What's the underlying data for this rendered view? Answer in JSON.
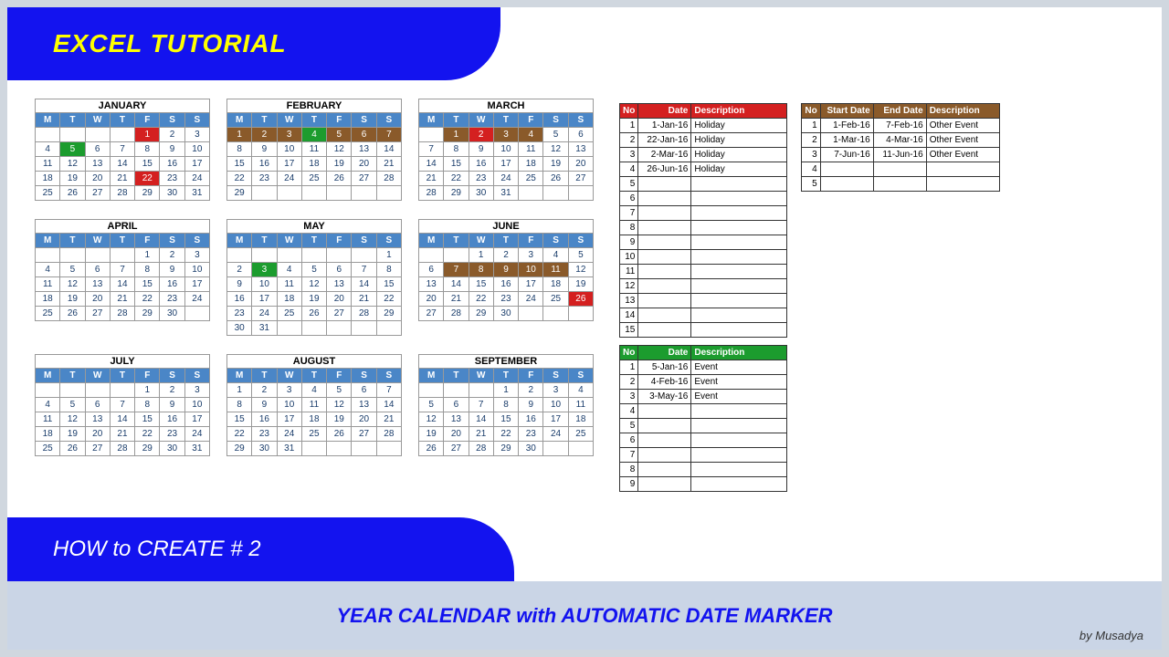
{
  "header": {
    "title": "EXCEL TUTORIAL"
  },
  "subheader": {
    "title": "HOW to CREATE # 2"
  },
  "footer": {
    "title": "YEAR CALENDAR with AUTOMATIC DATE MARKER",
    "byline": "by Musadya"
  },
  "dow": [
    "M",
    "T",
    "W",
    "T",
    "F",
    "S",
    "S"
  ],
  "months": [
    {
      "name": "JANUARY",
      "offset": 4,
      "days": 31,
      "marks": {
        "1": "red",
        "5": "green",
        "22": "red"
      }
    },
    {
      "name": "FEBRUARY",
      "offset": 0,
      "days": 29,
      "marks": {
        "1": "brown",
        "2": "brown",
        "3": "brown",
        "4": "green",
        "5": "brown",
        "6": "brown",
        "7": "brown"
      }
    },
    {
      "name": "MARCH",
      "offset": 1,
      "days": 31,
      "marks": {
        "1": "brown",
        "2": "red",
        "3": "brown",
        "4": "brown"
      }
    },
    {
      "name": "APRIL",
      "offset": 4,
      "days": 30,
      "marks": {}
    },
    {
      "name": "MAY",
      "offset": 6,
      "days": 31,
      "marks": {
        "3": "green"
      }
    },
    {
      "name": "JUNE",
      "offset": 2,
      "days": 30,
      "marks": {
        "7": "brown",
        "8": "brown",
        "9": "brown",
        "10": "brown",
        "11": "brown",
        "26": "red"
      }
    },
    {
      "name": "JULY",
      "offset": 4,
      "days": 31,
      "marks": {}
    },
    {
      "name": "AUGUST",
      "offset": 0,
      "days": 31,
      "marks": {}
    },
    {
      "name": "SEPTEMBER",
      "offset": 3,
      "days": 30,
      "marks": {}
    }
  ],
  "redTable": {
    "headers": [
      "No",
      "Date",
      "Description"
    ],
    "rows": [
      {
        "no": "1",
        "date": "1-Jan-16",
        "desc": "Holiday"
      },
      {
        "no": "2",
        "date": "22-Jan-16",
        "desc": "Holiday"
      },
      {
        "no": "3",
        "date": "2-Mar-16",
        "desc": "Holiday"
      },
      {
        "no": "4",
        "date": "26-Jun-16",
        "desc": "Holiday"
      },
      {
        "no": "5",
        "date": "",
        "desc": ""
      },
      {
        "no": "6",
        "date": "",
        "desc": ""
      },
      {
        "no": "7",
        "date": "",
        "desc": ""
      },
      {
        "no": "8",
        "date": "",
        "desc": ""
      },
      {
        "no": "9",
        "date": "",
        "desc": ""
      },
      {
        "no": "10",
        "date": "",
        "desc": ""
      },
      {
        "no": "11",
        "date": "",
        "desc": ""
      },
      {
        "no": "12",
        "date": "",
        "desc": ""
      },
      {
        "no": "13",
        "date": "",
        "desc": ""
      },
      {
        "no": "14",
        "date": "",
        "desc": ""
      },
      {
        "no": "15",
        "date": "",
        "desc": ""
      }
    ]
  },
  "greenTable": {
    "headers": [
      "No",
      "Date",
      "Description"
    ],
    "rows": [
      {
        "no": "1",
        "date": "5-Jan-16",
        "desc": "Event"
      },
      {
        "no": "2",
        "date": "4-Feb-16",
        "desc": "Event"
      },
      {
        "no": "3",
        "date": "3-May-16",
        "desc": "Event"
      },
      {
        "no": "4",
        "date": "",
        "desc": ""
      },
      {
        "no": "5",
        "date": "",
        "desc": ""
      },
      {
        "no": "6",
        "date": "",
        "desc": ""
      },
      {
        "no": "7",
        "date": "",
        "desc": ""
      },
      {
        "no": "8",
        "date": "",
        "desc": ""
      },
      {
        "no": "9",
        "date": "",
        "desc": ""
      }
    ]
  },
  "brownTable": {
    "headers": [
      "No",
      "Start Date",
      "End Date",
      "Description"
    ],
    "rows": [
      {
        "no": "1",
        "sd": "1-Feb-16",
        "ed": "7-Feb-16",
        "desc": "Other Event"
      },
      {
        "no": "2",
        "sd": "1-Mar-16",
        "ed": "4-Mar-16",
        "desc": "Other Event"
      },
      {
        "no": "3",
        "sd": "7-Jun-16",
        "ed": "11-Jun-16",
        "desc": "Other Event"
      },
      {
        "no": "4",
        "sd": "",
        "ed": "",
        "desc": ""
      },
      {
        "no": "5",
        "sd": "",
        "ed": "",
        "desc": ""
      }
    ]
  }
}
